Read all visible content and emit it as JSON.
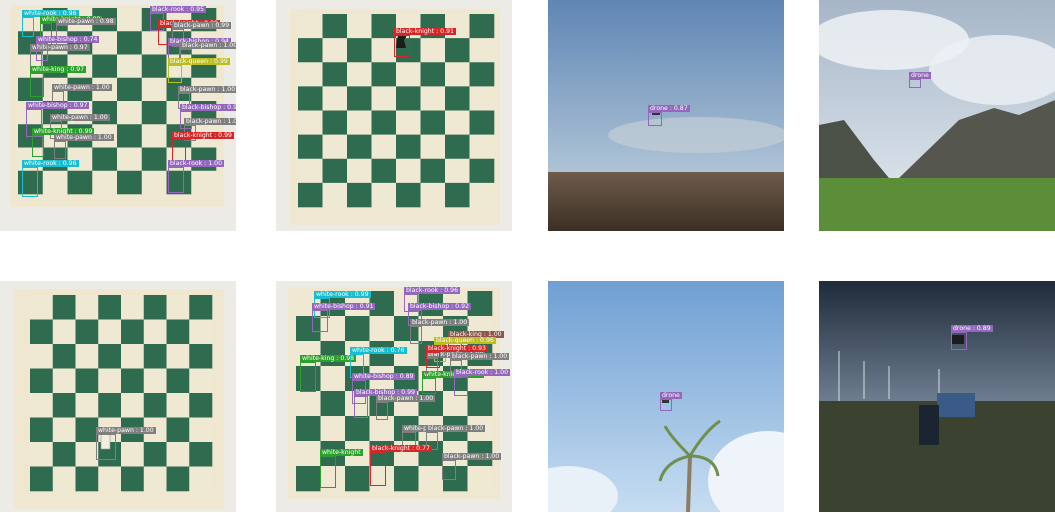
{
  "classes": {
    "white-rook": {
      "color": "#17becf"
    },
    "white-knight": {
      "color": "#2ca02c"
    },
    "white-bishop": {
      "color": "#9467bd"
    },
    "white-king": {
      "color": "#2ca02c"
    },
    "white-queen": {
      "color": "#8c564b"
    },
    "white-pawn": {
      "color": "#7f7f7f"
    },
    "black-rook": {
      "color": "#9467bd"
    },
    "black-knight": {
      "color": "#d62728"
    },
    "black-bishop": {
      "color": "#9467bd"
    },
    "black-king": {
      "color": "#8c564b"
    },
    "black-queen": {
      "color": "#bcbd22"
    },
    "black-pawn": {
      "color": "#7f7f7f"
    },
    "drone": {
      "color": "#9467bd"
    }
  },
  "panels": [
    {
      "id": "chess-start-1",
      "detections": [
        {
          "label": "white-rook : 0.96",
          "cls": "white-rook"
        },
        {
          "label": "white-knight : 0.98",
          "cls": "white-knight"
        },
        {
          "label": "white-pawn : 0.98",
          "cls": "white-pawn"
        },
        {
          "label": "white-pawn : 0.97",
          "cls": "white-pawn"
        },
        {
          "label": "white-bishop : 0.74",
          "cls": "white-bishop"
        },
        {
          "label": "white-king : 0.97",
          "cls": "white-king"
        },
        {
          "label": "white-pawn : 1.00",
          "cls": "white-pawn"
        },
        {
          "label": "white-bishop : 0.97",
          "cls": "white-bishop"
        },
        {
          "label": "white-pawn : 1.00",
          "cls": "white-pawn"
        },
        {
          "label": "white-knight : 0.99",
          "cls": "white-knight"
        },
        {
          "label": "white-pawn : 1.00",
          "cls": "white-pawn"
        },
        {
          "label": "white-rook : 0.96",
          "cls": "white-rook"
        },
        {
          "label": "black-rook : 0.95",
          "cls": "black-rook"
        },
        {
          "label": "black-knight : 0.98",
          "cls": "black-knight"
        },
        {
          "label": "black-pawn : 0.99",
          "cls": "black-pawn"
        },
        {
          "label": "black-bishop : 0.94",
          "cls": "black-bishop"
        },
        {
          "label": "black-pawn : 1.00",
          "cls": "black-pawn"
        },
        {
          "label": "black-queen : 0.99",
          "cls": "black-queen"
        },
        {
          "label": "black-pawn : 1.00",
          "cls": "black-pawn"
        },
        {
          "label": "black-bishop : 0.97",
          "cls": "black-bishop"
        },
        {
          "label": "black-pawn : 1.00",
          "cls": "black-pawn"
        },
        {
          "label": "black-knight : 0.99",
          "cls": "black-knight"
        },
        {
          "label": "black-rook : 1.00",
          "cls": "black-rook"
        }
      ]
    },
    {
      "id": "chess-single-knight",
      "detections": [
        {
          "label": "black-knight : 0.91",
          "cls": "black-knight"
        }
      ]
    },
    {
      "id": "drone-sky-desert",
      "detections": [
        {
          "label": "drone : 0.87",
          "cls": "drone"
        }
      ]
    },
    {
      "id": "drone-mountains",
      "detections": [
        {
          "label": "drone",
          "cls": "drone"
        }
      ]
    },
    {
      "id": "chess-single-pawn",
      "detections": [
        {
          "label": "white-pawn : 1.00",
          "cls": "white-pawn"
        }
      ]
    },
    {
      "id": "chess-midgame",
      "detections": [
        {
          "label": "white-rook : 0.99",
          "cls": "white-rook"
        },
        {
          "label": "white-bishop : 0.91",
          "cls": "white-bishop"
        },
        {
          "label": "white-king : 0.98",
          "cls": "white-king"
        },
        {
          "label": "white-rook : 0.76",
          "cls": "white-rook"
        },
        {
          "label": "white-bishop : 0.89",
          "cls": "white-bishop"
        },
        {
          "label": "white-knight : 0.93",
          "cls": "white-knight"
        },
        {
          "label": "white-pawn : 1.00",
          "cls": "white-pawn"
        },
        {
          "label": "white-knight",
          "cls": "white-knight"
        },
        {
          "label": "black-rook : 0.96",
          "cls": "black-rook"
        },
        {
          "label": "black-bishop : 0.92",
          "cls": "black-bishop"
        },
        {
          "label": "black-pawn : 1.00",
          "cls": "black-pawn"
        },
        {
          "label": "black-king : 1.00",
          "cls": "black-king"
        },
        {
          "label": "black-queen : 0.96",
          "cls": "black-queen"
        },
        {
          "label": "black-pawn : 1.00",
          "cls": "black-pawn"
        },
        {
          "label": "black-knight : 0.93",
          "cls": "black-knight"
        },
        {
          "label": "black-pawn : 1.00",
          "cls": "black-pawn"
        },
        {
          "label": "black-rook : 1.00",
          "cls": "black-rook"
        },
        {
          "label": "black-bishop : 0.99",
          "cls": "black-bishop"
        },
        {
          "label": "black-pawn : 1.00",
          "cls": "black-pawn"
        },
        {
          "label": "black-pawn : 1.00",
          "cls": "black-pawn"
        },
        {
          "label": "black-knight : 0.77",
          "cls": "black-knight"
        },
        {
          "label": "black-pawn : 1.00",
          "cls": "black-pawn"
        }
      ]
    },
    {
      "id": "drone-palm-sky",
      "detections": [
        {
          "label": "drone",
          "cls": "drone"
        }
      ]
    },
    {
      "id": "drone-truck-field",
      "detections": [
        {
          "label": "drone : 0.89",
          "cls": "drone"
        }
      ]
    }
  ]
}
